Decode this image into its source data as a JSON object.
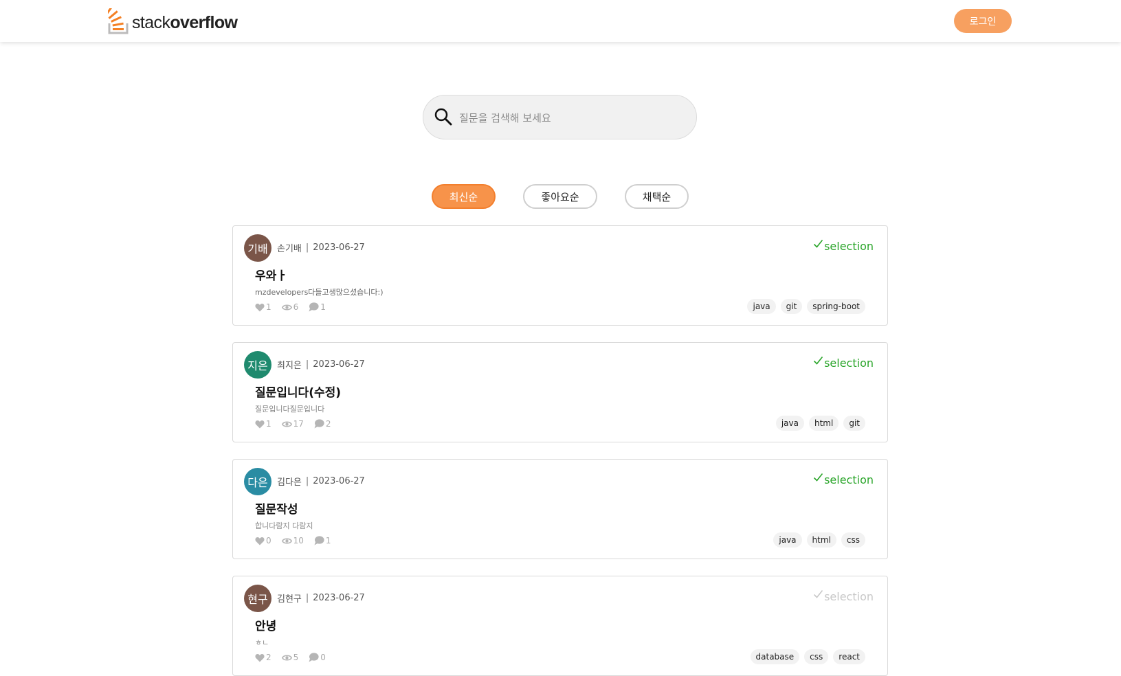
{
  "header": {
    "logo_light": "stack",
    "logo_bold": "overflow",
    "login_label": "로그인"
  },
  "search": {
    "placeholder": "질문을 검색해 보세요",
    "value": ""
  },
  "sort_tabs": [
    {
      "label": "최신순",
      "active": true
    },
    {
      "label": "좋아요순",
      "active": false
    },
    {
      "label": "채택순",
      "active": false
    }
  ],
  "colors": {
    "accent": "#f7934a",
    "selection_active": "#2aa52a",
    "selection_inactive": "#c8c8c8"
  },
  "questions": [
    {
      "avatar_text": "기배",
      "avatar_color": "#7a5548",
      "author": "손기배",
      "date": "2023-06-27",
      "selection_label": "selection",
      "selected": true,
      "title": "우와ㅏ",
      "excerpt": "mzdevelopers다들고생많으셨습니다:)",
      "likes": "1",
      "views": "6",
      "comments": "1",
      "tags": [
        "java",
        "git",
        "spring-boot"
      ]
    },
    {
      "avatar_text": "지은",
      "avatar_color": "#1f8a6e",
      "author": "최지은",
      "date": "2023-06-27",
      "selection_label": "selection",
      "selected": true,
      "title": "질문입니다(수정)",
      "excerpt": "질문입니다질문입니다",
      "likes": "1",
      "views": "17",
      "comments": "2",
      "tags": [
        "java",
        "html",
        "git"
      ]
    },
    {
      "avatar_text": "다은",
      "avatar_color": "#2a8ca3",
      "author": "김다은",
      "date": "2023-06-27",
      "selection_label": "selection",
      "selected": true,
      "title": "질문작성",
      "excerpt": "합니다람지 다람지",
      "likes": "0",
      "views": "10",
      "comments": "1",
      "tags": [
        "java",
        "html",
        "css"
      ]
    },
    {
      "avatar_text": "현구",
      "avatar_color": "#7a5548",
      "author": "김현구",
      "date": "2023-06-27",
      "selection_label": "selection",
      "selected": false,
      "title": "안녕",
      "excerpt": "ㅎㄴ",
      "likes": "2",
      "views": "5",
      "comments": "0",
      "tags": [
        "database",
        "css",
        "react"
      ]
    }
  ]
}
